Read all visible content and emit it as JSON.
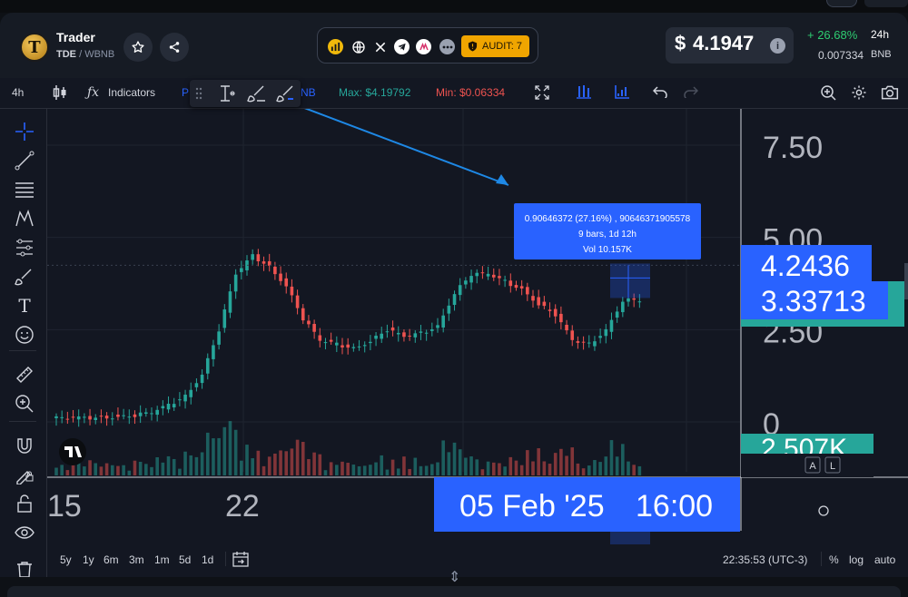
{
  "header": {
    "token_name": "Trader",
    "token_symbol": "TDE",
    "pair_separator": "/",
    "quote_symbol": "WBNB",
    "logo_letter": "T",
    "audit_label": "AUDIT: 7",
    "price_symbol": "$",
    "price_value": "4.1947",
    "change_pct": "+ 26.68%",
    "change_period": "24h",
    "bnb_value": "0.007334",
    "bnb_label": "BNB"
  },
  "toolbar": {
    "interval": "4h",
    "indicators_label": "Indicators",
    "symbol_partial_left": "P",
    "symbol_partial_right": "NB",
    "max_label": "Max: $4.19792",
    "min_label": "Min: $0.06334"
  },
  "chart": {
    "price_axis": [
      "7.50",
      "5.00",
      "2.50",
      "0"
    ],
    "date_axis": [
      "15",
      "22"
    ],
    "crosshair_price": "4.2436",
    "last_price_label": "3.33713",
    "volume_label": "2.507K",
    "crosshair_date": "05 Feb '25",
    "crosshair_time": "16:00",
    "measure_line1": "0.90646372 (27.16%) , 90646371905578",
    "measure_line2": "9 bars, 1d 12h",
    "measure_line3": "Vol 10.157K",
    "scale_a": "A",
    "scale_l": "L",
    "colors": {
      "up": "#26a69a",
      "down": "#ef5350",
      "accent": "#2962ff",
      "arrow": "#1e88e5"
    }
  },
  "chart_data": {
    "type": "candlestick",
    "interval": "4h",
    "ylim": [
      0,
      8.5
    ],
    "y_ticks": [
      0,
      2.5,
      5.0,
      7.5
    ],
    "x_tick_labels": [
      "15",
      "22"
    ],
    "approx_close_path": [
      0.1,
      0.1,
      0.12,
      0.15,
      0.18,
      0.25,
      0.45,
      0.7,
      1.3,
      2.5,
      4.0,
      4.5,
      4.2,
      3.7,
      2.8,
      2.2,
      2.1,
      2.0,
      2.2,
      2.5,
      2.3,
      2.4,
      2.6,
      3.5,
      4.0,
      4.0,
      3.8,
      3.6,
      3.2,
      2.9,
      2.2,
      2.1,
      2.5,
      3.3,
      3.3
    ],
    "measure": {
      "change": 0.90646372,
      "change_pct": 27.16,
      "bars": 9,
      "span": "1d 12h",
      "volume": "10.157K"
    },
    "last_price": 3.33713,
    "crosshair_price": 4.2436,
    "volume_last": "2.507K"
  },
  "bottom": {
    "ranges": [
      "5y",
      "1y",
      "6m",
      "3m",
      "1m",
      "5d",
      "1d"
    ],
    "clock": "22:35:53 (UTC-3)",
    "pct_label": "%",
    "log_label": "log",
    "auto_label": "auto"
  }
}
